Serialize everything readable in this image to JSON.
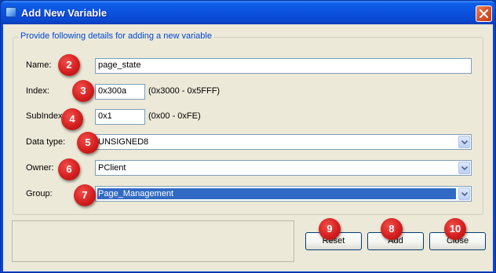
{
  "window": {
    "title": "Add New Variable",
    "close_icon": "close-x-icon"
  },
  "form": {
    "legend": "Provide following details for adding a new variable",
    "fields": {
      "name": {
        "label": "Name:",
        "value": "page_state"
      },
      "index": {
        "label": "Index:",
        "value": "0x300a",
        "range": "(0x3000 - 0x5FFF)"
      },
      "subindex": {
        "label": "SubIndex:",
        "value": "0x1",
        "range": "(0x00 - 0xFE)"
      },
      "data_type": {
        "label": "Data type:",
        "value": "UNSIGNED8"
      },
      "owner": {
        "label": "Owner:",
        "value": "PClient"
      },
      "group": {
        "label": "Group:",
        "value": "Page_Management"
      }
    }
  },
  "buttons": {
    "reset": "Reset",
    "add": "Add",
    "close": "Close"
  },
  "annotations": [
    "2",
    "3",
    "4",
    "5",
    "6",
    "7",
    "8",
    "9",
    "10"
  ],
  "colors": {
    "title_bar": "#0a4fdc",
    "selection": "#316ac5",
    "badge": "#d41f1f",
    "legend_text": "#0046d5"
  }
}
